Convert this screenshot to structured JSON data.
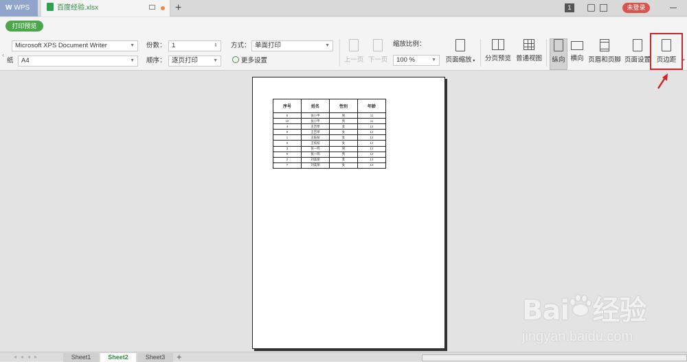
{
  "titlebar": {
    "wps_label": "WPS",
    "file_name": "百度经验.xlsx",
    "badge": "1",
    "login_label": "未登录"
  },
  "toolbar": {
    "print_preview_label": "打印预览",
    "printer": "Microsoft XPS Document Writer",
    "paper_label": "纸",
    "paper": "A4",
    "copies_label": "份数：",
    "copies_value": "1",
    "order_label": "顺序：",
    "order_value": "逐页打印",
    "mode_label": "方式：",
    "mode_value": "单面打印",
    "more_settings": "更多设置",
    "prev_page": "上一页",
    "next_page": "下一页",
    "zoom_label": "缩放比例：",
    "zoom_value": "100 %",
    "page_zoom": "页面缩放",
    "page_break_preview": "分页预览",
    "normal_view": "普通视图",
    "portrait": "纵向",
    "landscape": "横向",
    "header_footer": "页眉和页脚",
    "page_setup": "页面设置",
    "margins": "页边距"
  },
  "sheet": {
    "headers": [
      "序号",
      "姓名",
      "性别",
      "年龄"
    ],
    "rows": [
      [
        "8",
        "张小平",
        "男",
        "11"
      ],
      [
        "10",
        "张小平",
        "男",
        "11"
      ],
      [
        "4",
        "王百草",
        "女",
        "12"
      ],
      [
        "9",
        "王百草",
        "女",
        "12"
      ],
      [
        "1",
        "王枝枝",
        "女",
        "12"
      ],
      [
        "6",
        "王枝枝",
        "女",
        "12"
      ],
      [
        "3",
        "张一鸣",
        "男",
        "12"
      ],
      [
        "5",
        "张一鸣",
        "男",
        "12"
      ],
      [
        "2",
        "刘美丽",
        "女",
        "13"
      ],
      [
        "7",
        "刘美丽",
        "女",
        "13"
      ]
    ]
  },
  "sheet_tabs": [
    "Sheet1",
    "Sheet2",
    "Sheet3"
  ],
  "active_sheet_index": 1,
  "watermark": {
    "brand_left": "Bai",
    "brand_right": "经验",
    "url": "jingyan.baidu.com"
  },
  "colors": {
    "accent_green": "#4ca64c",
    "highlight_red": "#d0242b",
    "login_red": "#d9534f"
  }
}
